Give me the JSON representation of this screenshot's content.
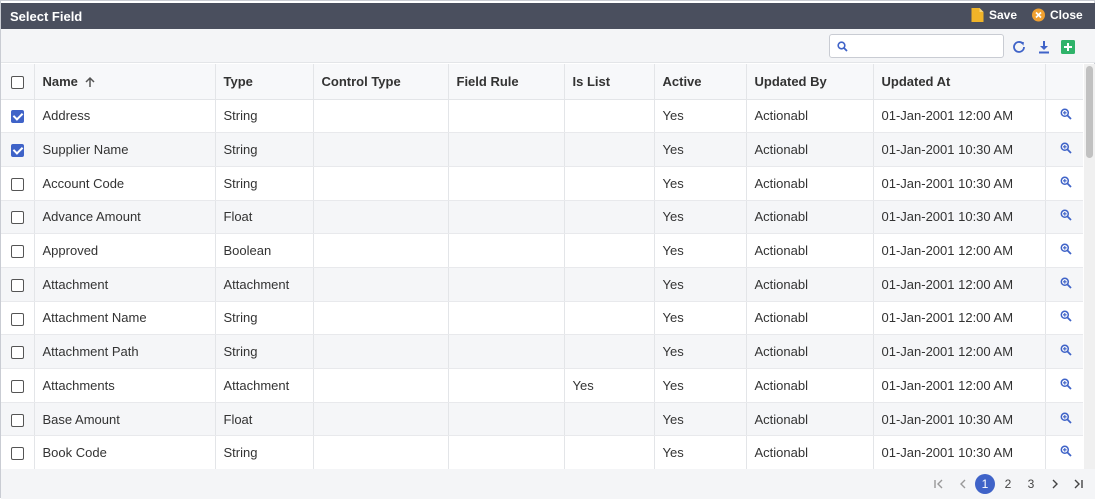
{
  "window": {
    "title": "Select Field"
  },
  "titlebar_actions": {
    "save_label": "Save",
    "close_label": "Close"
  },
  "toolbar": {
    "search_placeholder": "",
    "icons": [
      "refresh-icon",
      "download-icon",
      "add-icon"
    ]
  },
  "table": {
    "columns": [
      "Name",
      "Type",
      "Control Type",
      "Field Rule",
      "Is List",
      "Active",
      "Updated By",
      "Updated At"
    ],
    "sorted_column": "Name",
    "sort_direction": "ascending",
    "rows": [
      {
        "checked": true,
        "name": "Address",
        "type": "String",
        "control_type": "",
        "field_rule": "",
        "is_list": "",
        "active": "Yes",
        "updated_by": "Actionabl",
        "updated_at": "01-Jan-2001 12:00 AM"
      },
      {
        "checked": true,
        "name": "Supplier Name",
        "type": "String",
        "control_type": "",
        "field_rule": "",
        "is_list": "",
        "active": "Yes",
        "updated_by": "Actionabl",
        "updated_at": "01-Jan-2001 10:30 AM"
      },
      {
        "checked": false,
        "name": "Account Code",
        "type": "String",
        "control_type": "",
        "field_rule": "",
        "is_list": "",
        "active": "Yes",
        "updated_by": "Actionabl",
        "updated_at": "01-Jan-2001 10:30 AM"
      },
      {
        "checked": false,
        "name": "Advance Amount",
        "type": "Float",
        "control_type": "",
        "field_rule": "",
        "is_list": "",
        "active": "Yes",
        "updated_by": "Actionabl",
        "updated_at": "01-Jan-2001 10:30 AM"
      },
      {
        "checked": false,
        "name": "Approved",
        "type": "Boolean",
        "control_type": "",
        "field_rule": "",
        "is_list": "",
        "active": "Yes",
        "updated_by": "Actionabl",
        "updated_at": "01-Jan-2001 12:00 AM"
      },
      {
        "checked": false,
        "name": "Attachment",
        "type": "Attachment",
        "control_type": "",
        "field_rule": "",
        "is_list": "",
        "active": "Yes",
        "updated_by": "Actionabl",
        "updated_at": "01-Jan-2001 12:00 AM"
      },
      {
        "checked": false,
        "name": "Attachment Name",
        "type": "String",
        "control_type": "",
        "field_rule": "",
        "is_list": "",
        "active": "Yes",
        "updated_by": "Actionabl",
        "updated_at": "01-Jan-2001 12:00 AM"
      },
      {
        "checked": false,
        "name": "Attachment Path",
        "type": "String",
        "control_type": "",
        "field_rule": "",
        "is_list": "",
        "active": "Yes",
        "updated_by": "Actionabl",
        "updated_at": "01-Jan-2001 12:00 AM"
      },
      {
        "checked": false,
        "name": "Attachments",
        "type": "Attachment",
        "control_type": "",
        "field_rule": "",
        "is_list": "Yes",
        "active": "Yes",
        "updated_by": "Actionabl",
        "updated_at": "01-Jan-2001 12:00 AM"
      },
      {
        "checked": false,
        "name": "Base Amount",
        "type": "Float",
        "control_type": "",
        "field_rule": "",
        "is_list": "",
        "active": "Yes",
        "updated_by": "Actionabl",
        "updated_at": "01-Jan-2001 10:30 AM"
      },
      {
        "checked": false,
        "name": "Book Code",
        "type": "String",
        "control_type": "",
        "field_rule": "",
        "is_list": "",
        "active": "Yes",
        "updated_by": "Actionabl",
        "updated_at": "01-Jan-2001 10:30 AM"
      }
    ]
  },
  "pagination": {
    "current_page": 1,
    "pages": [
      "1",
      "2",
      "3"
    ]
  },
  "colors": {
    "titlebar": "#4a4f5e",
    "accent": "#3f63c8",
    "save_icon": "#f0b429",
    "close_icon": "#f0a030",
    "add_icon": "#2fb36a"
  }
}
